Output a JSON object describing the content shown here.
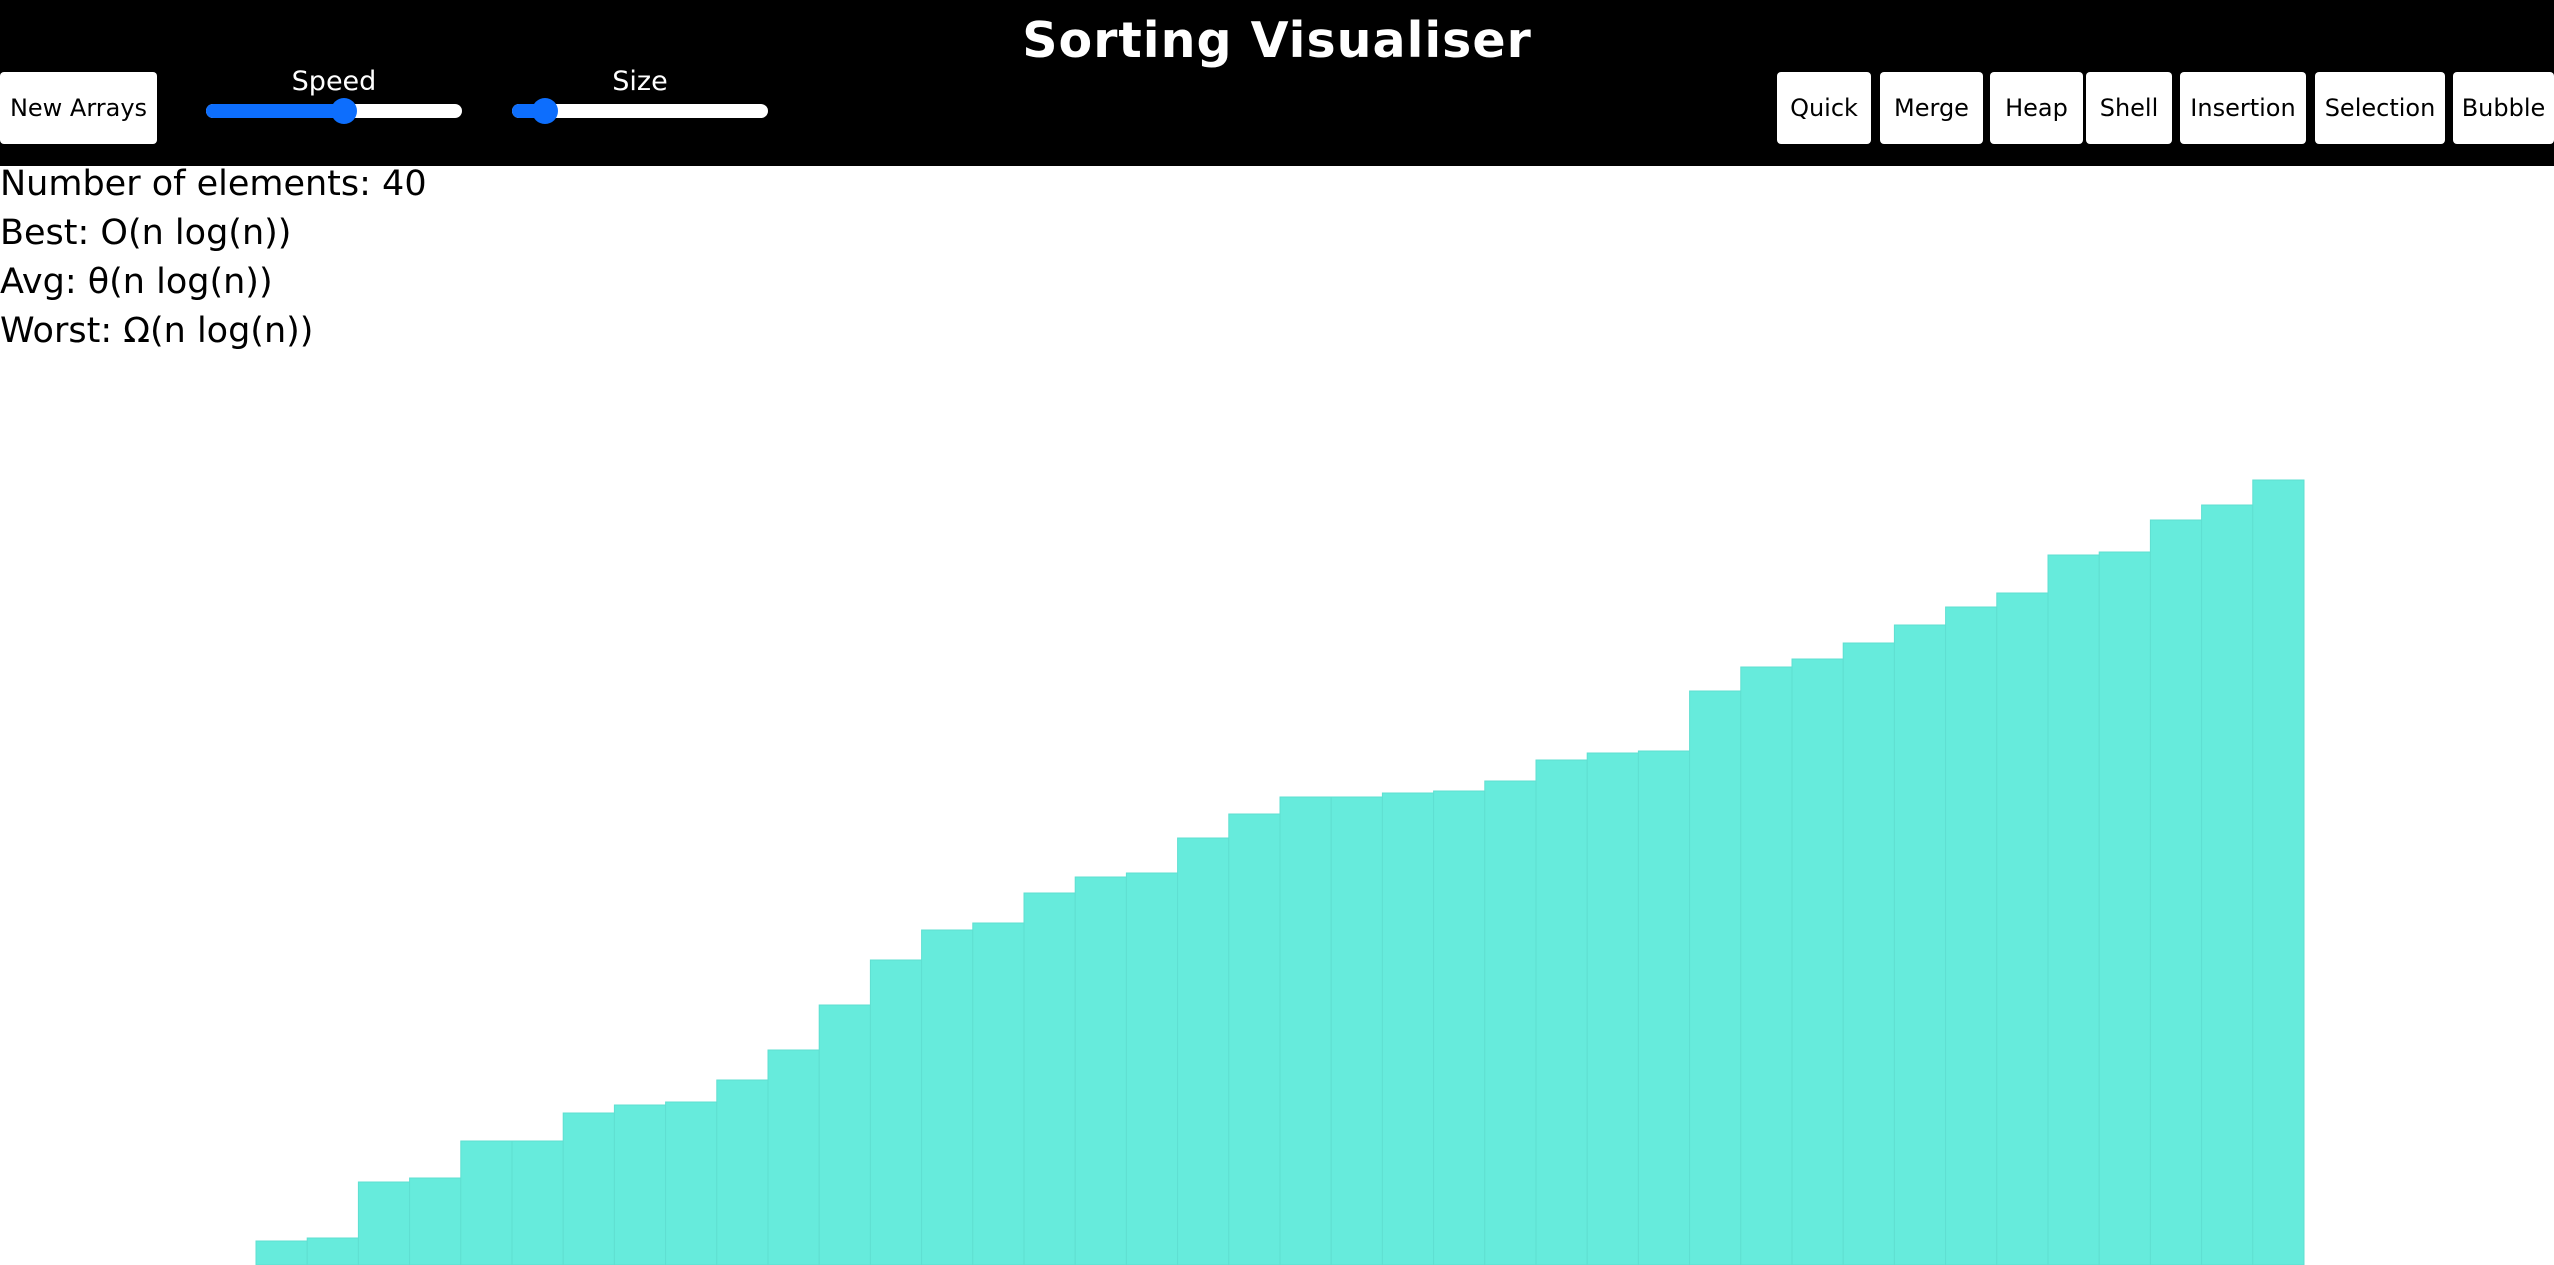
{
  "header": {
    "title": "Sorting Visualiser",
    "new_arrays_label": "New Arrays",
    "speed_label": "Speed",
    "size_label": "Size",
    "speed_value": 0.54,
    "size_value": 0.13,
    "algorithms": [
      "Quick",
      "Merge",
      "Heap",
      "Shell",
      "Insertion",
      "Selection",
      "Bubble"
    ]
  },
  "info": {
    "count_label": "Number of elements: 40",
    "best": "Best: O(n log(n))",
    "avg": "Avg: θ(n log(n))",
    "worst": "Worst: Ω(n log(n))"
  },
  "colors": {
    "header_bg": "#000000",
    "bar": "#66ebdc",
    "slider_accent": "#0d6efd"
  },
  "chart_data": {
    "type": "bar",
    "values": [
      24,
      27,
      83,
      87,
      124,
      124,
      152,
      160,
      163,
      185,
      215,
      260,
      305,
      335,
      342,
      372,
      388,
      392,
      427,
      451,
      468,
      468,
      472,
      474,
      484,
      505,
      512,
      514,
      574,
      598,
      606,
      622,
      640,
      658,
      672,
      710,
      713,
      745,
      760,
      785
    ]
  }
}
